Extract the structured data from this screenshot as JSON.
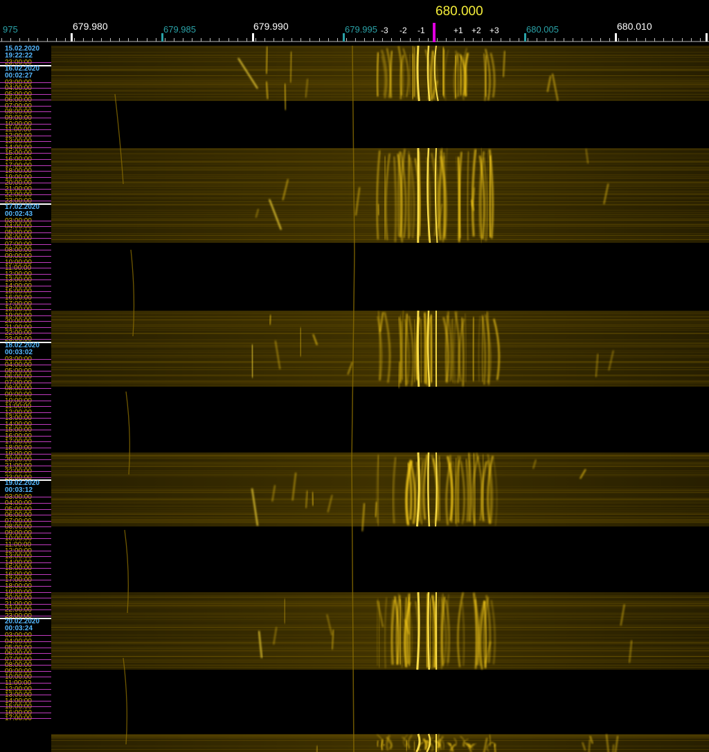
{
  "scale": {
    "center_freq": "680.000",
    "freq_labels": [
      {
        "text": "975",
        "minor": true
      },
      {
        "text": "679.980",
        "minor": false
      },
      {
        "text": "679.985",
        "minor": true
      },
      {
        "text": "679.990",
        "minor": false
      },
      {
        "text": "679.995",
        "minor": true
      },
      {
        "text": "680.005",
        "minor": true
      },
      {
        "text": "680.010",
        "minor": false
      }
    ],
    "offsets": [
      "-3",
      "-2",
      "-1",
      "+1",
      "+2",
      "+3"
    ]
  },
  "timeaxis": {
    "days": [
      {
        "date": "15.02.2020",
        "start": "19:22:22",
        "hours": [
          "23:00:00"
        ]
      },
      {
        "date": "16.02.2020",
        "start": "00:02:27",
        "hours": [
          "03:00:00",
          "04:00:00",
          "05:00:00",
          "06:00:00",
          "07:00:00",
          "08:00:00",
          "09:00:00",
          "10:00:00",
          "11:00:00",
          "12:00:00",
          "13:00:00",
          "14:00:00",
          "15:00:00",
          "16:00:00",
          "17:00:00",
          "18:00:00",
          "19:00:00",
          "20:00:00",
          "21:00:00",
          "22:00:00",
          "23:00:00"
        ]
      },
      {
        "date": "17.02.2020",
        "start": "00:02:43",
        "hours": [
          "03:00:00",
          "04:00:00",
          "05:00:00",
          "06:00:00",
          "07:00:00",
          "08:00:00",
          "09:00:00",
          "10:00:00",
          "11:00:00",
          "12:00:00",
          "13:00:00",
          "14:00:00",
          "15:00:00",
          "16:00:00",
          "17:00:00",
          "18:00:00",
          "19:00:00",
          "20:00:00",
          "21:00:00",
          "22:00:00",
          "23:00:00"
        ]
      },
      {
        "date": "18.02.2020",
        "start": "00:03:02",
        "hours": [
          "03:00:00",
          "04:00:00",
          "05:00:00",
          "06:00:00",
          "07:00:00",
          "08:00:00",
          "09:00:00",
          "10:00:00",
          "11:00:00",
          "12:00:00",
          "13:00:00",
          "14:00:00",
          "15:00:00",
          "16:00:00",
          "17:00:00",
          "18:00:00",
          "19:00:00",
          "20:00:00",
          "21:00:00",
          "22:00:00",
          "23:00:00"
        ]
      },
      {
        "date": "19.02.2020",
        "start": "00:03:12",
        "hours": [
          "03:00:00",
          "04:00:00",
          "05:00:00",
          "06:00:00",
          "07:00:00",
          "08:00:00",
          "09:00:00",
          "10:00:00",
          "11:00:00",
          "12:00:00",
          "13:00:00",
          "14:00:00",
          "15:00:00",
          "16:00:00",
          "17:00:00",
          "18:00:00",
          "19:00:00",
          "20:00:00",
          "21:00:00",
          "22:00:00",
          "23:00:00"
        ]
      },
      {
        "date": "20.02.2020",
        "start": "00:03:24",
        "hours": [
          "03:00:00",
          "04:00:00",
          "05:00:00",
          "06:00:00",
          "07:00:00",
          "08:00:00",
          "09:00:00",
          "10:00:00",
          "11:00:00",
          "12:00:00",
          "13:00:00",
          "14:00:00",
          "15:00:00",
          "16:00:00",
          "17:00:00"
        ]
      }
    ]
  },
  "colors": {
    "signal": "#ffd21a",
    "band": "#3a2e00",
    "time_text": "#d9b300",
    "date_text": "#55b9ff",
    "center_marker": "#e000e0",
    "hour_line": "#c13bc1"
  }
}
